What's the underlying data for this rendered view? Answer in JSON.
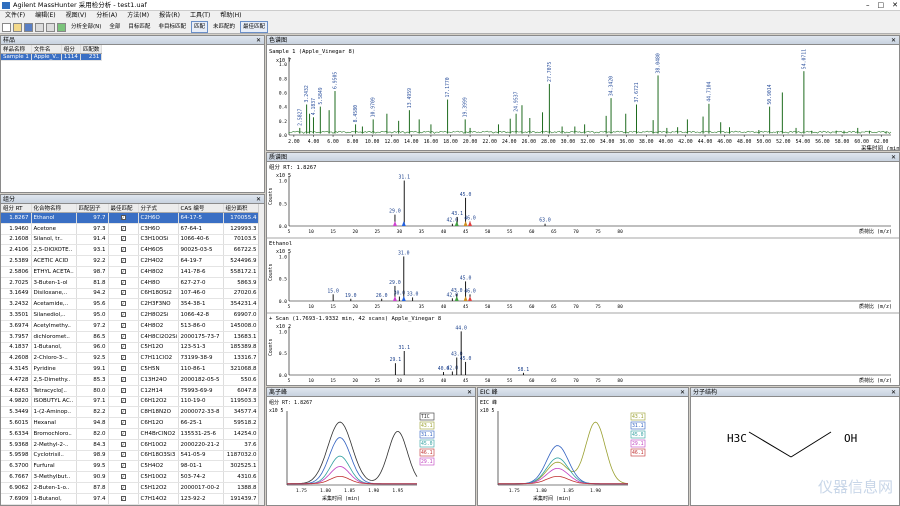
{
  "app": {
    "title": "Agilent MassHunter 采用检分析 - test1.uaf"
  },
  "menu": [
    "文件(F)",
    "编辑(E)",
    "视图(V)",
    "分析(A)",
    "方法(M)",
    "报告(R)",
    "工具(T)",
    "帮助(H)"
  ],
  "toolbar": {
    "analyze_all": "分析全部(N)",
    "all": "全部",
    "target_matched": "目标匹配",
    "non_target_matched": "非目标匹配",
    "matched": "匹配",
    "unmatched": "未匹配的",
    "best_match": "最佳匹配"
  },
  "samples_panel": {
    "title": "样品",
    "headers": [
      "样品名称",
      "文件名",
      "组分",
      "匹配数"
    ],
    "row": {
      "name": "Sample 1",
      "file": "Apple_V..",
      "comp": "1114",
      "match": "231"
    }
  },
  "comp_panel": {
    "title": "组分",
    "headers": [
      "组分 RT",
      "化合物名称",
      "匹配因子",
      "最佳匹配",
      "分子式",
      "CAS 编号",
      "组分面积"
    ],
    "rows": [
      [
        "1.8267",
        "Ethanol",
        "97.7",
        "C2H6O",
        "64-17-5",
        "170055.4"
      ],
      [
        "1.9460",
        "Acetone",
        "97.3",
        "C3H6O",
        "67-64-1",
        "129993.3"
      ],
      [
        "2.1608",
        "Silanol, tr..",
        "91.4",
        "C3H10OSi",
        "1066-40-6",
        "70103.5"
      ],
      [
        "2.4106",
        "2,5-DIOXOTE..",
        "93.1",
        "C4H6O5",
        "90025-03-5",
        "66722.5"
      ],
      [
        "2.5389",
        "ACETIC ACID",
        "92.2",
        "C2H4O2",
        "64-19-7",
        "524496.9"
      ],
      [
        "2.5806",
        "ETHYL ACETA..",
        "98.7",
        "C4H8O2",
        "141-78-6",
        "558172.1"
      ],
      [
        "2.7025",
        "3-Buten-1-ol",
        "81.8",
        "C4H8O",
        "627-27-0",
        "5863.9"
      ],
      [
        "3.1649",
        "Disiloxane,..",
        "94.2",
        "C6H18OSi2",
        "107-46-0",
        "27020.6"
      ],
      [
        "3.2432",
        "Acetamide,..",
        "95.6",
        "C2H3F3NO",
        "354-38-1",
        "354231.4"
      ],
      [
        "3.3501",
        "Silanediol,..",
        "95.0",
        "C2H8O2Si",
        "1066-42-8",
        "69907.0"
      ],
      [
        "3.6974",
        "Acetylmethy..",
        "97.2",
        "C4H8O2",
        "513-86-0",
        "145008.0"
      ],
      [
        "3.7957",
        "dichloromet..",
        "86.5",
        "C4H8Cl2O2Si",
        "2000175-73-7",
        "13683.1"
      ],
      [
        "4.1837",
        "1-Butanol,",
        "96.0",
        "C5H12O",
        "123-51-3",
        "185389.8"
      ],
      [
        "4.2608",
        "2-Chloro-3-..",
        "92.5",
        "C7H11ClO2",
        "73199-38-9",
        "13316.7"
      ],
      [
        "4.3145",
        "Pyridine",
        "99.1",
        "C5H5N",
        "110-86-1",
        "321068.8"
      ],
      [
        "4.4728",
        "2,5-Dimethy..",
        "85.3",
        "C13H24O",
        "2000182-05-5",
        "550.6"
      ],
      [
        "4.8263",
        "Tetracyclo[..",
        "80.0",
        "C12H14",
        "75993-69-9",
        "6047.8"
      ],
      [
        "4.9820",
        "ISOBUTYL AC..",
        "97.1",
        "C6H12O2",
        "110-19-0",
        "119503.3"
      ],
      [
        "5.3449",
        "1-(2-Aminop..",
        "82.2",
        "C8H18N2O",
        "2000072-33-8",
        "34577.4"
      ],
      [
        "5.6015",
        "Hexanal",
        "94.8",
        "C6H12O",
        "66-25-1",
        "59518.2"
      ],
      [
        "5.6334",
        "Bromochloro..",
        "82.0",
        "CH4BrClNO2",
        "135531-25-6",
        "14254.0"
      ],
      [
        "5.9368",
        "2-Methyl-2-..",
        "84.3",
        "C6H10O2",
        "2000220-21-2",
        "37.6"
      ],
      [
        "5.9598",
        "Cyclotrisil..",
        "98.9",
        "C6H18O3Si3",
        "541-05-9",
        "1187032.0"
      ],
      [
        "6.3700",
        "Furfural",
        "99.5",
        "C5H4O2",
        "98-01-1",
        "302525.1"
      ],
      [
        "6.7667",
        "3-Methylbut..",
        "90.9",
        "C5H10O2",
        "503-74-2",
        "4310.6"
      ],
      [
        "6.9062",
        "2-Buten-1-o..",
        "87.8",
        "C5H12O2",
        "2000017-00-2",
        "1388.8"
      ],
      [
        "7.6909",
        "1-Butanol,",
        "97.4",
        "C7H14O2",
        "123-92-2",
        "191439.7"
      ]
    ]
  },
  "tic_panel": {
    "title": "色谱图",
    "label": "Sample 1 (Apple_Vinegar 8)",
    "yaxis": "Counts",
    "scale": "x10 7",
    "xlabel": "采集时间 (min)"
  },
  "spectrum_panel": {
    "title": "质谱图",
    "s1_label": "组分 RT: 1.8267",
    "s2_label": "Ethanol",
    "s3_label": "+ Scan (1.7693-1.9332 min, 42 scans) Apple_Vinegar 8",
    "scale": "x10 5",
    "scale2": "x10 2",
    "yaxis": "Counts",
    "xlabel": "质荷比 (m/z)"
  },
  "eic_panel": {
    "title": "离子峰",
    "label": "组分 RT: 1.8267",
    "scale": "x10 5",
    "xlabel": "采集时间 (min)",
    "legend": [
      "TIC",
      "43.1",
      "31.1",
      "45.0",
      "46.1",
      "29.1"
    ]
  },
  "xic_panel": {
    "title": "EIC 峰",
    "label": "EIC 峰",
    "legend": [
      "43.1",
      "31.1",
      "45.0",
      "29.1",
      "46.1"
    ]
  },
  "struct_panel": {
    "title": "分子结构",
    "left": "H3C",
    "right": "OH"
  },
  "watermark": "仪器信息网",
  "chart_data": {
    "type": "line",
    "tic": {
      "xlim": [
        1.5,
        63
      ],
      "ylim": [
        0,
        1.1
      ],
      "y_unit": "x10^7",
      "xticks": [
        2,
        4,
        6,
        8,
        10,
        12,
        14,
        16,
        18,
        20,
        22,
        24,
        26,
        28,
        30,
        32,
        34,
        36,
        38,
        40,
        42,
        44,
        46,
        48,
        50,
        52,
        54,
        56,
        58,
        60,
        62
      ],
      "peaks": [
        [
          2.6,
          0.1
        ],
        [
          3.3,
          0.43
        ],
        [
          3.6,
          0.3
        ],
        [
          4.0,
          0.25
        ],
        [
          4.7,
          0.4
        ],
        [
          5.6,
          0.35
        ],
        [
          6.2,
          0.62
        ],
        [
          8.3,
          0.15
        ],
        [
          9.0,
          0.12
        ],
        [
          10.1,
          0.22
        ],
        [
          11.5,
          0.3
        ],
        [
          12.7,
          0.2
        ],
        [
          13.8,
          0.35
        ],
        [
          14.8,
          0.22
        ],
        [
          16.0,
          0.15
        ],
        [
          17.7,
          0.5
        ],
        [
          19.5,
          0.22
        ],
        [
          20.0,
          0.1
        ],
        [
          22.9,
          0.15
        ],
        [
          24.1,
          0.23
        ],
        [
          24.7,
          0.3
        ],
        [
          25.3,
          0.42
        ],
        [
          26.1,
          0.24
        ],
        [
          27.4,
          0.32
        ],
        [
          28.1,
          0.72
        ],
        [
          29.4,
          0.12
        ],
        [
          30.7,
          0.12
        ],
        [
          31.7,
          0.15
        ],
        [
          33.9,
          0.27
        ],
        [
          34.4,
          0.52
        ],
        [
          35.9,
          0.3
        ],
        [
          37.0,
          0.43
        ],
        [
          38.7,
          0.21
        ],
        [
          39.2,
          0.84
        ],
        [
          40.1,
          0.1
        ],
        [
          41.2,
          0.11
        ],
        [
          42.2,
          0.22
        ],
        [
          43.8,
          0.26
        ],
        [
          44.4,
          0.44
        ],
        [
          45.6,
          0.18
        ],
        [
          46.5,
          0.11
        ],
        [
          49.5,
          0.07
        ],
        [
          50.6,
          0.4
        ],
        [
          51.4,
          0.04
        ],
        [
          51.9,
          0.6
        ],
        [
          53.3,
          0.1
        ],
        [
          54.1,
          0.9
        ],
        [
          54.9,
          0.06
        ],
        [
          57.4,
          0.06
        ],
        [
          58.2,
          0.06
        ],
        [
          59.6,
          0.1
        ],
        [
          60.8,
          0.06
        ],
        [
          62.5,
          0.05
        ]
      ],
      "labels": [
        [
          2.6,
          "2.5827"
        ],
        [
          3.3,
          "3.2432"
        ],
        [
          4.0,
          "4.1837"
        ],
        [
          4.7,
          "5.5849"
        ],
        [
          6.2,
          "6.9505"
        ],
        [
          8.3,
          "8.4580"
        ],
        [
          10.1,
          "10.9709"
        ],
        [
          13.8,
          "13.4959"
        ],
        [
          17.7,
          "17.1770"
        ],
        [
          19.5,
          "19.3999"
        ],
        [
          24.7,
          "24.9537"
        ],
        [
          28.1,
          "27.7075"
        ],
        [
          34.4,
          "34.3420"
        ],
        [
          37.0,
          "37.6721"
        ],
        [
          39.2,
          "38.0480"
        ],
        [
          44.4,
          "44.7104"
        ],
        [
          50.6,
          "50.9014"
        ],
        [
          54.1,
          "54.0711"
        ]
      ]
    },
    "spectrum1": {
      "ylim": [
        0,
        1.1
      ],
      "xlim": [
        5,
        80
      ],
      "bars": [
        [
          29.0,
          0.25
        ],
        [
          31.1,
          1.0
        ],
        [
          42.0,
          0.05
        ],
        [
          43.1,
          0.2
        ],
        [
          45.0,
          0.62
        ],
        [
          46.0,
          0.1
        ],
        [
          63.0,
          0.05
        ]
      ]
    },
    "spectrum2": {
      "ylim": [
        0,
        1.1
      ],
      "xlim": [
        5,
        80
      ],
      "bars": [
        [
          15.0,
          0.15
        ],
        [
          19.0,
          0.05
        ],
        [
          26.0,
          0.05
        ],
        [
          29.0,
          0.34
        ],
        [
          30.0,
          0.1
        ],
        [
          31.0,
          1.0
        ],
        [
          33.0,
          0.08
        ],
        [
          42.0,
          0.06
        ],
        [
          43.0,
          0.16
        ],
        [
          45.0,
          0.44
        ],
        [
          46.0,
          0.15
        ]
      ]
    },
    "spectrum3": {
      "ylim": [
        0,
        1.1
      ],
      "xlim": [
        5,
        80
      ],
      "bars": [
        [
          29.1,
          0.27
        ],
        [
          31.1,
          0.55
        ],
        [
          40.0,
          0.07
        ],
        [
          42.0,
          0.08
        ],
        [
          43.0,
          0.4
        ],
        [
          44.0,
          1.0
        ],
        [
          45.0,
          0.3
        ],
        [
          58.1,
          0.05
        ]
      ]
    },
    "eic": {
      "xticks": [
        1.75,
        1.8,
        1.85,
        1.9,
        1.95
      ],
      "xlim": [
        1.72,
        1.99
      ],
      "ylim": [
        0,
        1.2
      ]
    },
    "xic": {
      "xticks": [
        1.75,
        1.8,
        1.85,
        1.9
      ],
      "xlim": [
        1.72,
        1.96
      ],
      "ylim": [
        0,
        1.2
      ]
    }
  }
}
